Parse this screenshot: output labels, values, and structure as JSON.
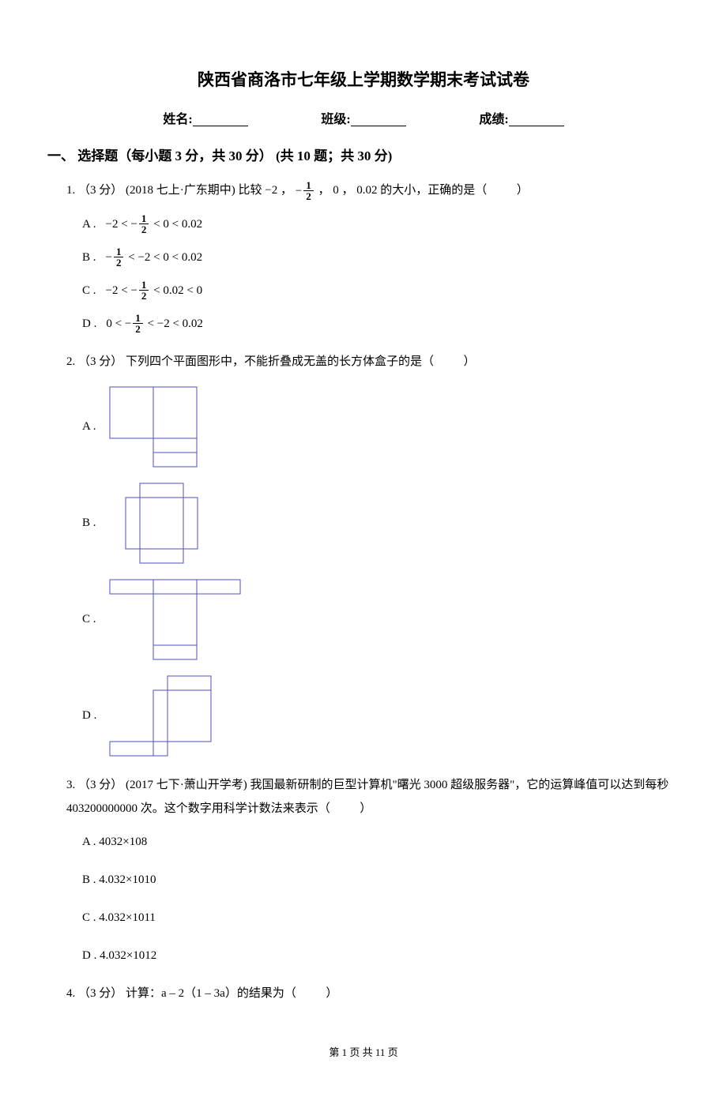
{
  "title": "陕西省商洛市七年级上学期数学期末考试试卷",
  "header": {
    "name_label": "姓名:",
    "class_label": "班级:",
    "score_label": "成绩:"
  },
  "section1": "一、 选择题（每小题 3 分，共 30 分） (共 10 题；共 30 分)",
  "q1": {
    "number": "1.",
    "points": "（3 分）",
    "source": "(2018 七上·广东期中)",
    "text1": "比较 −2 ，",
    "text2": "， 0 ， 0.02 的大小，正确的是（",
    "text3": "）",
    "optA_label": "A .",
    "optA_p1": "−2 <",
    "optA_p2": "< 0 < 0.02",
    "optB_label": "B .",
    "optB_p1": "",
    "optB_p2": "< −2 < 0 < 0.02",
    "optC_label": "C .",
    "optC_p1": "−2 <",
    "optC_p2": "< 0.02 < 0",
    "optD_label": "D .",
    "optD_p1": "0 <",
    "optD_p2": "< −2 < 0.02"
  },
  "q2": {
    "number": "2.",
    "points": "（3 分）",
    "text": "下列四个平面图形中，不能折叠成无盖的长方体盒子的是（",
    "text2": "）",
    "optA_label": "A .",
    "optB_label": "B .",
    "optC_label": "C .",
    "optD_label": "D ."
  },
  "q3": {
    "number": "3.",
    "points": "（3 分）",
    "source": "(2017 七下·萧山开学考)",
    "text1": "我国最新研制的巨型计算机\"曙光 3000 超级服务器\"，它的运算峰值可以达到每秒 403200000000 次。这个数字用科学计数法来表示（",
    "text2": "）",
    "optA": "A . 4032×108",
    "optB": "B . 4.032×1010",
    "optC": "C . 4.032×1011",
    "optD": "D . 4.032×1012"
  },
  "q4": {
    "number": "4.",
    "points": "（3 分）",
    "text": "计算：a – 2（1 – 3a）的结果为（",
    "text2": "）"
  },
  "footer": {
    "prefix": "第",
    "current": "1",
    "mid": "页 共",
    "total": "11",
    "suffix": "页"
  }
}
